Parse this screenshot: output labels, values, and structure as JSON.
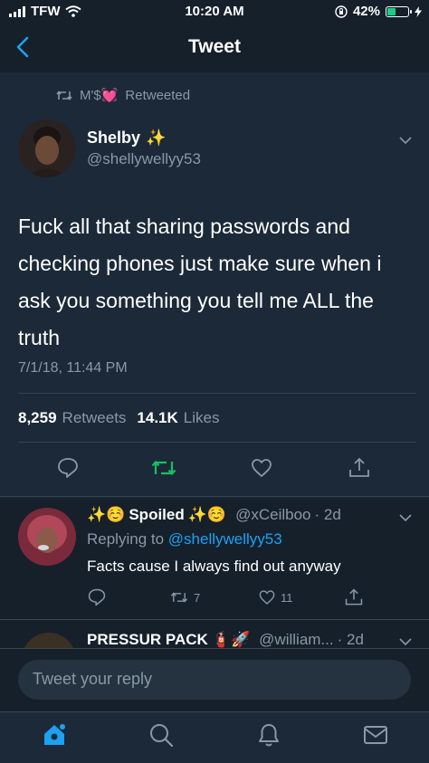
{
  "status_bar": {
    "carrier": "TFW",
    "time": "10:20 AM",
    "battery_percent_label": "42%",
    "battery_level": 0.42
  },
  "nav": {
    "title": "Tweet"
  },
  "tweet": {
    "retweeted_by": "M'$",
    "retweeted_by_emoji": "💓",
    "retweeted_label": "Retweeted",
    "author_name": "Shelby",
    "author_emoji": "✨",
    "handle": "@shellywellyy53",
    "text": "Fuck all that sharing passwords and checking phones just make sure when i ask you something you tell me ALL the truth",
    "timestamp": "7/1/18, 11:44 PM",
    "retweets_count": "8,259",
    "retweets_label": "Retweets",
    "likes_count": "14.1K",
    "likes_label": "Likes"
  },
  "replies": [
    {
      "name_prefix": "✨☺️",
      "name": "Spoiled",
      "name_suffix": "✨☺️",
      "handle": "@xCeilboo",
      "time": "· 2d",
      "replying_label": "Replying to",
      "replying_to": "@shellywellyy53",
      "text": "Facts cause I always find out anyway",
      "retweets": "7",
      "likes": "11"
    },
    {
      "name": "PRESSUR PACK",
      "name_suffix": "🧯🚀",
      "handle": "@william...",
      "time": "· 2d"
    }
  ],
  "compose": {
    "placeholder": "Tweet your reply"
  },
  "colors": {
    "accent": "#1da1f2",
    "retweet_green": "#17bf63",
    "muted": "#8899a6",
    "background": "#15202b",
    "card": "#1c2938"
  }
}
